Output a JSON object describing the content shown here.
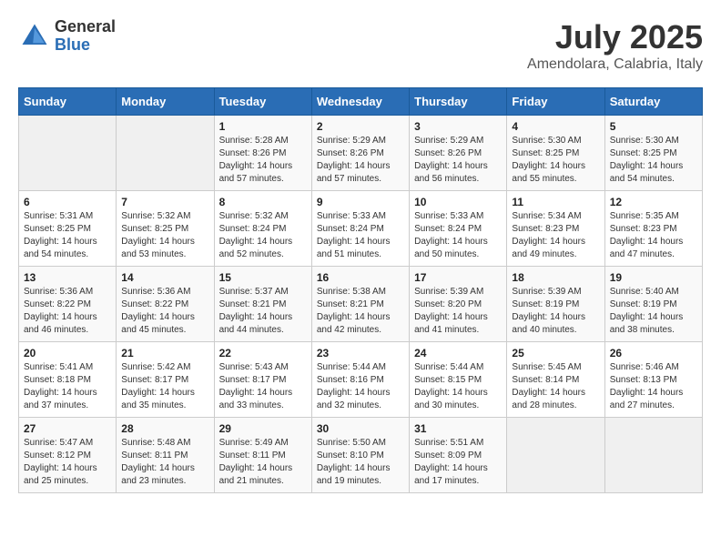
{
  "logo": {
    "general": "General",
    "blue": "Blue"
  },
  "title": {
    "month_year": "July 2025",
    "location": "Amendolara, Calabria, Italy"
  },
  "calendar": {
    "headers": [
      "Sunday",
      "Monday",
      "Tuesday",
      "Wednesday",
      "Thursday",
      "Friday",
      "Saturday"
    ],
    "weeks": [
      [
        {
          "day": "",
          "sunrise": "",
          "sunset": "",
          "daylight": ""
        },
        {
          "day": "",
          "sunrise": "",
          "sunset": "",
          "daylight": ""
        },
        {
          "day": "1",
          "sunrise": "Sunrise: 5:28 AM",
          "sunset": "Sunset: 8:26 PM",
          "daylight": "Daylight: 14 hours and 57 minutes."
        },
        {
          "day": "2",
          "sunrise": "Sunrise: 5:29 AM",
          "sunset": "Sunset: 8:26 PM",
          "daylight": "Daylight: 14 hours and 57 minutes."
        },
        {
          "day": "3",
          "sunrise": "Sunrise: 5:29 AM",
          "sunset": "Sunset: 8:26 PM",
          "daylight": "Daylight: 14 hours and 56 minutes."
        },
        {
          "day": "4",
          "sunrise": "Sunrise: 5:30 AM",
          "sunset": "Sunset: 8:25 PM",
          "daylight": "Daylight: 14 hours and 55 minutes."
        },
        {
          "day": "5",
          "sunrise": "Sunrise: 5:30 AM",
          "sunset": "Sunset: 8:25 PM",
          "daylight": "Daylight: 14 hours and 54 minutes."
        }
      ],
      [
        {
          "day": "6",
          "sunrise": "Sunrise: 5:31 AM",
          "sunset": "Sunset: 8:25 PM",
          "daylight": "Daylight: 14 hours and 54 minutes."
        },
        {
          "day": "7",
          "sunrise": "Sunrise: 5:32 AM",
          "sunset": "Sunset: 8:25 PM",
          "daylight": "Daylight: 14 hours and 53 minutes."
        },
        {
          "day": "8",
          "sunrise": "Sunrise: 5:32 AM",
          "sunset": "Sunset: 8:24 PM",
          "daylight": "Daylight: 14 hours and 52 minutes."
        },
        {
          "day": "9",
          "sunrise": "Sunrise: 5:33 AM",
          "sunset": "Sunset: 8:24 PM",
          "daylight": "Daylight: 14 hours and 51 minutes."
        },
        {
          "day": "10",
          "sunrise": "Sunrise: 5:33 AM",
          "sunset": "Sunset: 8:24 PM",
          "daylight": "Daylight: 14 hours and 50 minutes."
        },
        {
          "day": "11",
          "sunrise": "Sunrise: 5:34 AM",
          "sunset": "Sunset: 8:23 PM",
          "daylight": "Daylight: 14 hours and 49 minutes."
        },
        {
          "day": "12",
          "sunrise": "Sunrise: 5:35 AM",
          "sunset": "Sunset: 8:23 PM",
          "daylight": "Daylight: 14 hours and 47 minutes."
        }
      ],
      [
        {
          "day": "13",
          "sunrise": "Sunrise: 5:36 AM",
          "sunset": "Sunset: 8:22 PM",
          "daylight": "Daylight: 14 hours and 46 minutes."
        },
        {
          "day": "14",
          "sunrise": "Sunrise: 5:36 AM",
          "sunset": "Sunset: 8:22 PM",
          "daylight": "Daylight: 14 hours and 45 minutes."
        },
        {
          "day": "15",
          "sunrise": "Sunrise: 5:37 AM",
          "sunset": "Sunset: 8:21 PM",
          "daylight": "Daylight: 14 hours and 44 minutes."
        },
        {
          "day": "16",
          "sunrise": "Sunrise: 5:38 AM",
          "sunset": "Sunset: 8:21 PM",
          "daylight": "Daylight: 14 hours and 42 minutes."
        },
        {
          "day": "17",
          "sunrise": "Sunrise: 5:39 AM",
          "sunset": "Sunset: 8:20 PM",
          "daylight": "Daylight: 14 hours and 41 minutes."
        },
        {
          "day": "18",
          "sunrise": "Sunrise: 5:39 AM",
          "sunset": "Sunset: 8:19 PM",
          "daylight": "Daylight: 14 hours and 40 minutes."
        },
        {
          "day": "19",
          "sunrise": "Sunrise: 5:40 AM",
          "sunset": "Sunset: 8:19 PM",
          "daylight": "Daylight: 14 hours and 38 minutes."
        }
      ],
      [
        {
          "day": "20",
          "sunrise": "Sunrise: 5:41 AM",
          "sunset": "Sunset: 8:18 PM",
          "daylight": "Daylight: 14 hours and 37 minutes."
        },
        {
          "day": "21",
          "sunrise": "Sunrise: 5:42 AM",
          "sunset": "Sunset: 8:17 PM",
          "daylight": "Daylight: 14 hours and 35 minutes."
        },
        {
          "day": "22",
          "sunrise": "Sunrise: 5:43 AM",
          "sunset": "Sunset: 8:17 PM",
          "daylight": "Daylight: 14 hours and 33 minutes."
        },
        {
          "day": "23",
          "sunrise": "Sunrise: 5:44 AM",
          "sunset": "Sunset: 8:16 PM",
          "daylight": "Daylight: 14 hours and 32 minutes."
        },
        {
          "day": "24",
          "sunrise": "Sunrise: 5:44 AM",
          "sunset": "Sunset: 8:15 PM",
          "daylight": "Daylight: 14 hours and 30 minutes."
        },
        {
          "day": "25",
          "sunrise": "Sunrise: 5:45 AM",
          "sunset": "Sunset: 8:14 PM",
          "daylight": "Daylight: 14 hours and 28 minutes."
        },
        {
          "day": "26",
          "sunrise": "Sunrise: 5:46 AM",
          "sunset": "Sunset: 8:13 PM",
          "daylight": "Daylight: 14 hours and 27 minutes."
        }
      ],
      [
        {
          "day": "27",
          "sunrise": "Sunrise: 5:47 AM",
          "sunset": "Sunset: 8:12 PM",
          "daylight": "Daylight: 14 hours and 25 minutes."
        },
        {
          "day": "28",
          "sunrise": "Sunrise: 5:48 AM",
          "sunset": "Sunset: 8:11 PM",
          "daylight": "Daylight: 14 hours and 23 minutes."
        },
        {
          "day": "29",
          "sunrise": "Sunrise: 5:49 AM",
          "sunset": "Sunset: 8:11 PM",
          "daylight": "Daylight: 14 hours and 21 minutes."
        },
        {
          "day": "30",
          "sunrise": "Sunrise: 5:50 AM",
          "sunset": "Sunset: 8:10 PM",
          "daylight": "Daylight: 14 hours and 19 minutes."
        },
        {
          "day": "31",
          "sunrise": "Sunrise: 5:51 AM",
          "sunset": "Sunset: 8:09 PM",
          "daylight": "Daylight: 14 hours and 17 minutes."
        },
        {
          "day": "",
          "sunrise": "",
          "sunset": "",
          "daylight": ""
        },
        {
          "day": "",
          "sunrise": "",
          "sunset": "",
          "daylight": ""
        }
      ]
    ]
  }
}
